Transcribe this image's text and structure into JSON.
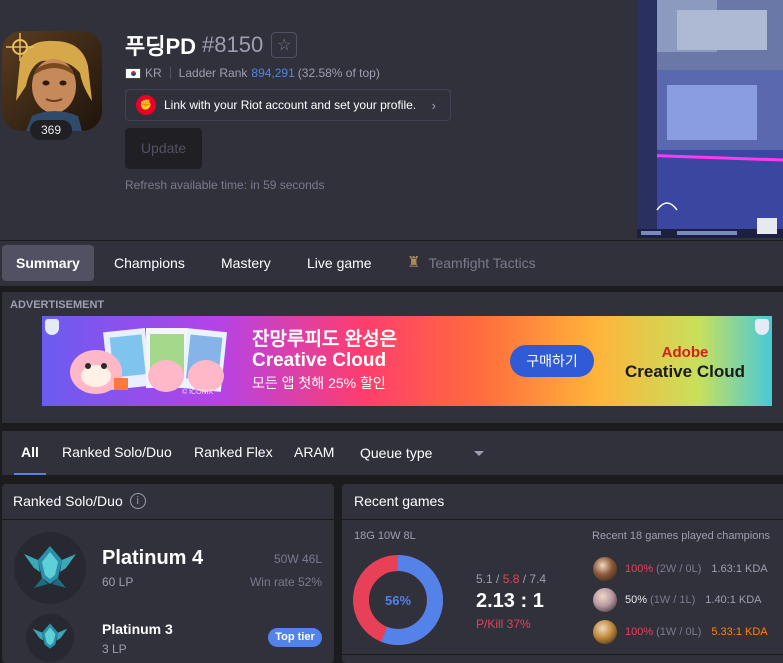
{
  "profile": {
    "name": "푸딩PD",
    "tagline": "#8150",
    "level": "369",
    "region": "KR",
    "ladder_label": "Ladder Rank",
    "ladder_rank": "894,291",
    "ladder_pct": "(32.58% of top)",
    "riot_link": "Link with your Riot account and set your profile.",
    "update_label": "Update",
    "refresh_text": "Refresh available time: in 59 seconds"
  },
  "tabs": [
    "Summary",
    "Champions",
    "Mastery",
    "Live game",
    "Teamfight Tactics"
  ],
  "ad": {
    "label": "ADVERTISEMENT",
    "headline_1": "잔망루피도 완성은",
    "headline_2": "Creative Cloud",
    "sub": "모든 앱 첫해 25% 할인",
    "cta": "구매하기",
    "brand_1": "Adobe",
    "brand_2": "Creative Cloud",
    "credit": "© ICONIX"
  },
  "queue": {
    "all": "All",
    "solo": "Ranked Solo/Duo",
    "flex": "Ranked Flex",
    "aram": "ARAM",
    "select": "Queue type"
  },
  "ranked": {
    "title": "Ranked Solo/Duo",
    "info_icon": "i",
    "current": {
      "tier": "Platinum 4",
      "lp": "60 LP",
      "wl": "50W 46L",
      "winrate": "Win rate 52%"
    },
    "peak": {
      "tier": "Platinum 3",
      "lp": "3 LP",
      "badge": "Top tier"
    }
  },
  "recent": {
    "title": "Recent games",
    "summary": "18G 10W 8L",
    "winrate_label": "56%",
    "winrate": 0.56,
    "kills": "5.1",
    "deaths": "5.8",
    "assists": "7.4",
    "kda": "2.13 : 1",
    "pkill": "P/Kill 37%",
    "champs_title": "Recent 18 games played champions",
    "champions": [
      {
        "wr": "100%",
        "wl": "(2W / 0L)",
        "kda": "1.63:1 KDA",
        "hot": true,
        "orange": false,
        "color": "#8a5a3a"
      },
      {
        "wr": "50%",
        "wl": "(1W / 1L)",
        "kda": "1.40:1 KDA",
        "hot": false,
        "orange": false,
        "color": "#b89aa6"
      },
      {
        "wr": "100%",
        "wl": "(1W / 0L)",
        "kda": "5.33:1 KDA",
        "hot": true,
        "orange": true,
        "color": "#c08a3a"
      }
    ]
  },
  "colors": {
    "win": "#5383e8",
    "loss": "#e84057",
    "accent": "#5383e8"
  }
}
